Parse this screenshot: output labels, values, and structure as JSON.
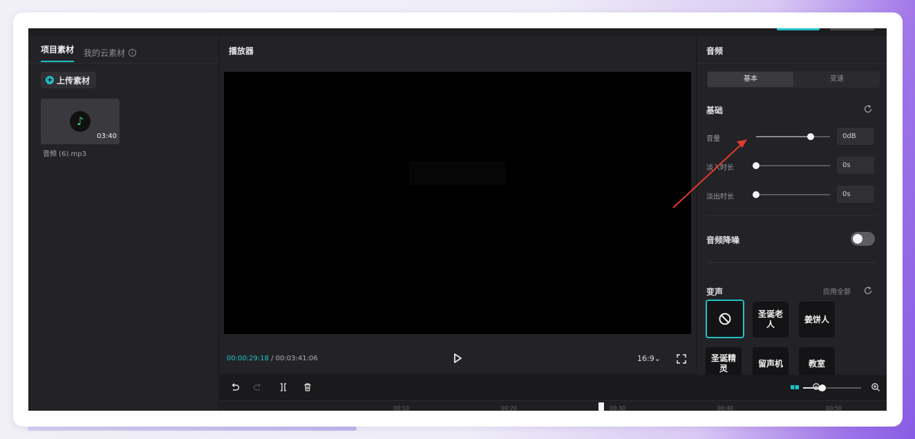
{
  "left_panel": {
    "tabs": [
      {
        "label": "项目素材",
        "active": true
      },
      {
        "label": "我的云素材",
        "active": false
      }
    ],
    "info_icon": "ⓘ",
    "upload_button": "上传素材",
    "media": {
      "duration": "03:40",
      "filename": "音频 (6).mp3",
      "icon": "music-note-icon"
    }
  },
  "player": {
    "title": "播放器",
    "current_time": "00:00:29:18",
    "separator": " / ",
    "total_time": "00:03:41:06",
    "aspect_ratio": "16:9⌄"
  },
  "audio_panel": {
    "title": "音频",
    "segments": [
      {
        "label": "基本",
        "active": true
      },
      {
        "label": "变速",
        "active": false
      }
    ],
    "basic_section": "基础",
    "rows": [
      {
        "label": "音量",
        "value": "0dB",
        "level": 0.74
      },
      {
        "label": "淡入时长",
        "value": "0s",
        "level": 0.0
      },
      {
        "label": "淡出时长",
        "value": "0s",
        "level": 0.0
      }
    ],
    "noise_reduction": {
      "label": "音频降噪",
      "enabled": false
    },
    "voice_changer": {
      "title": "变声",
      "apply_all": "应用全部",
      "options": [
        {
          "label": "none-icon",
          "selected": true
        },
        {
          "label": "圣诞老人",
          "selected": false
        },
        {
          "label": "姜饼人",
          "selected": false
        },
        {
          "label": "圣诞精灵",
          "selected": false
        },
        {
          "label": "留声机",
          "selected": false
        },
        {
          "label": "教室",
          "selected": false
        }
      ]
    }
  },
  "timeline": {
    "ticks": [
      "00:10",
      "00:20",
      "00:30",
      "00:40",
      "00:50"
    ],
    "zoom_level": 0.33
  },
  "colors": {
    "accent": "#1fc3c9",
    "annotation_arrow": "#e23a2e",
    "panel_bg": "#232327"
  }
}
